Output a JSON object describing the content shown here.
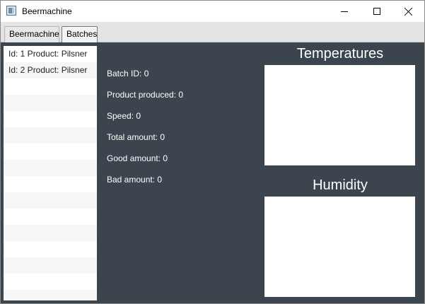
{
  "window": {
    "title": "Beermachine",
    "icon": "app-window-icon"
  },
  "tabs": [
    {
      "label": "Beermachine",
      "selected": false
    },
    {
      "label": "Batches",
      "selected": true
    }
  ],
  "batch_list": {
    "items": [
      {
        "label": "Id: 1 Product: Pilsner"
      },
      {
        "label": "Id: 2 Product: Pilsner"
      }
    ]
  },
  "details": {
    "batch_id": "Batch ID:  0",
    "product_produced": "Product produced:  0",
    "speed": "Speed:  0",
    "total_amount": "Total amount: 0",
    "good_amount": "Good amount: 0",
    "bad_amount": "Bad amount: 0"
  },
  "panels": {
    "temperatures_title": "Temperatures",
    "humidity_title": "Humidity"
  },
  "colors": {
    "background": "#3c454e",
    "selected_tab_border": "#2a8fd3"
  }
}
